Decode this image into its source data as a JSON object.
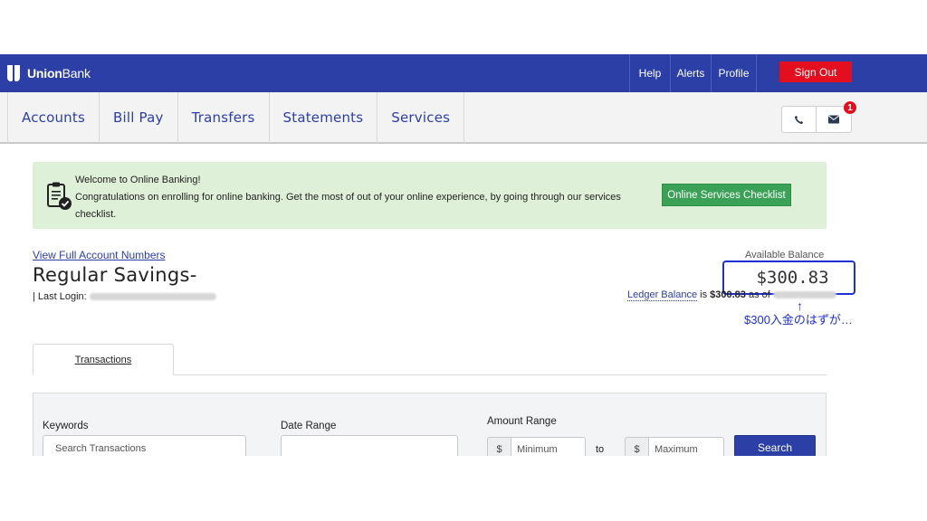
{
  "header": {
    "logo_bold": "Union",
    "logo_light": "Bank",
    "links": {
      "help": "Help",
      "alerts": "Alerts",
      "profile": "Profile"
    },
    "sign_out": "Sign Out",
    "brand_color": "#2b3fa6",
    "sign_out_color": "#e30f1e"
  },
  "nav": {
    "items": [
      "Accounts",
      "Bill Pay",
      "Transfers",
      "Statements",
      "Services"
    ],
    "icons": {
      "phone": "phone-icon",
      "mail": "mail-icon"
    },
    "badge_count": "1"
  },
  "banner": {
    "title": "Welcome to Online Banking!",
    "message": "Congratulations on enrolling for online banking. Get the most of out of your online experience, by going through our services checklist.",
    "button": "Online Services Checklist",
    "icon": "clipboard-check-icon",
    "background_color": "#dff0d8",
    "button_color": "#3aa157"
  },
  "account": {
    "view_full_link": "View Full Account Numbers",
    "title": "Regular Savings-",
    "last_login_label": "| Last Login:",
    "available_balance_label": "Available Balance",
    "available_balance": "$300.83",
    "ledger_link": "Ledger Balance",
    "ledger_is": "is",
    "ledger_value": "$300.83",
    "ledger_as_of": "as of"
  },
  "annotation": {
    "arrow": "↑",
    "text": "$300入金のはずが…",
    "color": "#1f2fd6"
  },
  "tabs": {
    "transactions": "Transactions"
  },
  "search": {
    "keywords_label": "Keywords",
    "keywords_placeholder": "Search Transactions",
    "date_label": "Date Range",
    "date_value": "",
    "amount_label": "Amount Range",
    "currency_symbol": "$",
    "min_placeholder": "Minimum",
    "to_label": "to",
    "max_placeholder": "Maximum",
    "search_button": "Search"
  }
}
